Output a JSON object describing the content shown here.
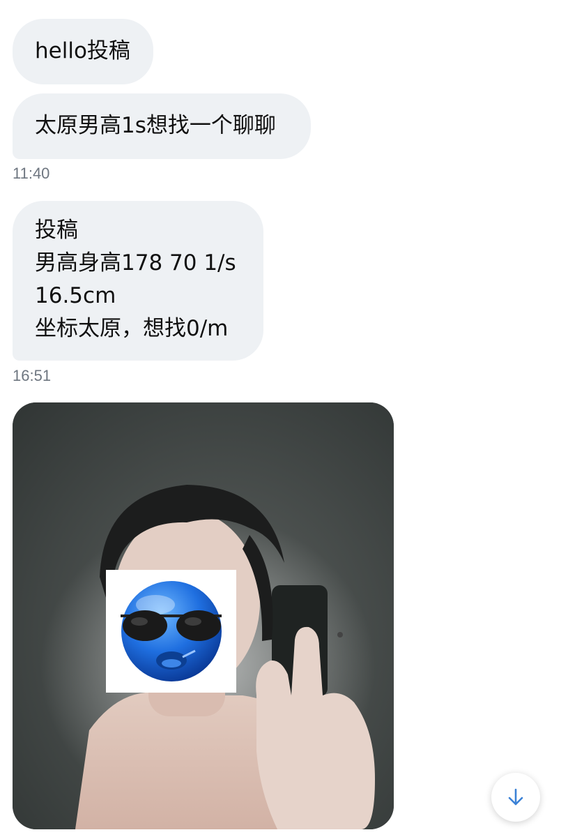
{
  "messages": [
    {
      "text": "hello投稿"
    },
    {
      "text": "太原男高1s想找一个聊聊"
    },
    {
      "time": "11:40"
    },
    {
      "lines": [
        "投稿",
        "男高身高178 70 1/s",
        "16.5cm",
        "坐标太原，想找0/m"
      ]
    },
    {
      "time": "16:51"
    }
  ],
  "icons": {
    "scroll_down": "arrow-down-icon",
    "face_sticker": "blue-sunglasses-emoji-sticker"
  },
  "colors": {
    "bubble_bg": "#eef1f4",
    "timestamp": "#6e7680",
    "accent": "#3b82d6"
  }
}
